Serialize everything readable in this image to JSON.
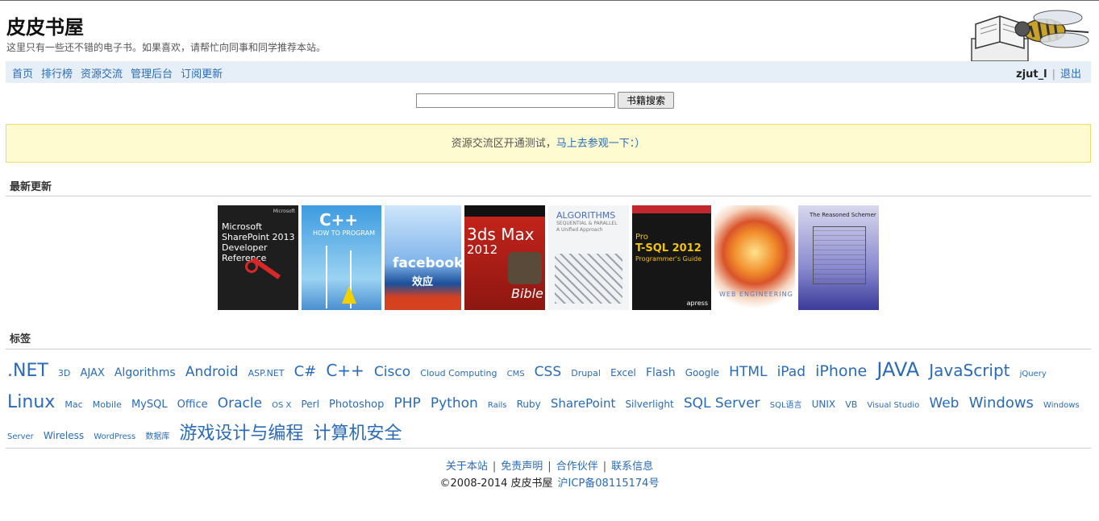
{
  "site": {
    "title": "皮皮书屋",
    "subtitle": "这里只有一些还不错的电子书。如果喜欢，请帮忙向同事和同学推荐本站。"
  },
  "nav": {
    "links": [
      "首页",
      "排行榜",
      "资源交流",
      "管理后台",
      "订阅更新"
    ],
    "username": "zjut_l",
    "logout": "退出"
  },
  "search": {
    "placeholder": "",
    "button": "书籍搜索"
  },
  "notice": {
    "text": "资源交流区开通测试，",
    "link": "马上去参观一下：）"
  },
  "sections": {
    "latest": "最新更新",
    "tags": "标签"
  },
  "books": [
    {
      "title": "Microsoft SharePoint 2013 Developer Reference",
      "lines": [
        "Microsoft",
        "SharePoint 2013",
        "Developer",
        "Reference"
      ],
      "bg": "#1e1e1e"
    },
    {
      "title": "C++ How to Program",
      "lines": [
        "C++",
        "HOW TO PROGRAM"
      ],
      "bg": "#4aa6de"
    },
    {
      "title": "facebook效应",
      "lines": [
        "facebook",
        "效应"
      ],
      "bg": "#1b4f9a"
    },
    {
      "title": "3ds Max 2012 Bible",
      "lines": [
        "3ds Max",
        "2012",
        "Bible"
      ],
      "bg": "#b8211a"
    },
    {
      "title": "Algorithms Sequential & Parallel",
      "lines": [
        "ALGORITHMS",
        "SEQUENTIAL & PARALLEL",
        "A Unified Approach"
      ],
      "bg": "#f2f4f6"
    },
    {
      "title": "Pro T-SQL 2012 Programmer's Guide",
      "lines": [
        "Pro",
        "T-SQL 2012",
        "Programmer's Guide",
        "apress"
      ],
      "bg": "#161616"
    },
    {
      "title": "Web Engineering",
      "lines": [
        "WEB ENGINEERING"
      ],
      "bg": "#e88a3a"
    },
    {
      "title": "The Reasoned Schemer",
      "lines": [
        "The Reasoned Schemer"
      ],
      "bg": "#6a6ab8"
    }
  ],
  "tags": [
    {
      "text": ".NET",
      "size": 22
    },
    {
      "text": "3D",
      "size": 11
    },
    {
      "text": "AJAX",
      "size": 13
    },
    {
      "text": "Algorithms",
      "size": 14
    },
    {
      "text": "Android",
      "size": 17
    },
    {
      "text": "ASP.NET",
      "size": 11
    },
    {
      "text": "C#",
      "size": 18
    },
    {
      "text": "C++",
      "size": 20
    },
    {
      "text": "Cisco",
      "size": 17
    },
    {
      "text": "Cloud Computing",
      "size": 11
    },
    {
      "text": "CMS",
      "size": 10
    },
    {
      "text": "CSS",
      "size": 17
    },
    {
      "text": "Drupal",
      "size": 11
    },
    {
      "text": "Excel",
      "size": 12
    },
    {
      "text": "Flash",
      "size": 14
    },
    {
      "text": "Google",
      "size": 12
    },
    {
      "text": "HTML",
      "size": 17
    },
    {
      "text": "iPad",
      "size": 17
    },
    {
      "text": "iPhone",
      "size": 19
    },
    {
      "text": "JAVA",
      "size": 24
    },
    {
      "text": "JavaScript",
      "size": 20
    },
    {
      "text": "jQuery",
      "size": 10
    },
    {
      "text": "Linux",
      "size": 22
    },
    {
      "text": "Mac",
      "size": 11
    },
    {
      "text": "Mobile",
      "size": 11
    },
    {
      "text": "MySQL",
      "size": 13
    },
    {
      "text": "Office",
      "size": 13
    },
    {
      "text": "Oracle",
      "size": 17
    },
    {
      "text": "OS X",
      "size": 10
    },
    {
      "text": "Perl",
      "size": 12
    },
    {
      "text": "Photoshop",
      "size": 13
    },
    {
      "text": "PHP",
      "size": 17
    },
    {
      "text": "Python",
      "size": 17
    },
    {
      "text": "Rails",
      "size": 10
    },
    {
      "text": "Ruby",
      "size": 12
    },
    {
      "text": "SharePoint",
      "size": 15
    },
    {
      "text": "Silverlight",
      "size": 12
    },
    {
      "text": "SQL Server",
      "size": 17
    },
    {
      "text": "SQL语言",
      "size": 10
    },
    {
      "text": "UNIX",
      "size": 12
    },
    {
      "text": "VB",
      "size": 11
    },
    {
      "text": "Visual Studio",
      "size": 10
    },
    {
      "text": "Web",
      "size": 17
    },
    {
      "text": "Windows",
      "size": 18
    },
    {
      "text": "Windows Server",
      "size": 10
    },
    {
      "text": "Wireless",
      "size": 12
    },
    {
      "text": "WordPress",
      "size": 10
    },
    {
      "text": "数据库",
      "size": 10
    },
    {
      "text": "游戏设计与编程",
      "size": 22
    },
    {
      "text": "计算机安全",
      "size": 22
    }
  ],
  "footer": {
    "links": [
      "关于本站",
      "免责声明",
      "合作伙伴",
      "联系信息"
    ],
    "copyright": "©2008-2014 皮皮书屋",
    "icp": "沪ICP备08115174号"
  },
  "colors": {
    "link": "#2a6bb8",
    "navbar_bg": "#e6eef8",
    "notice_bg": "#fffbd0",
    "notice_border": "#f0dc6a"
  }
}
